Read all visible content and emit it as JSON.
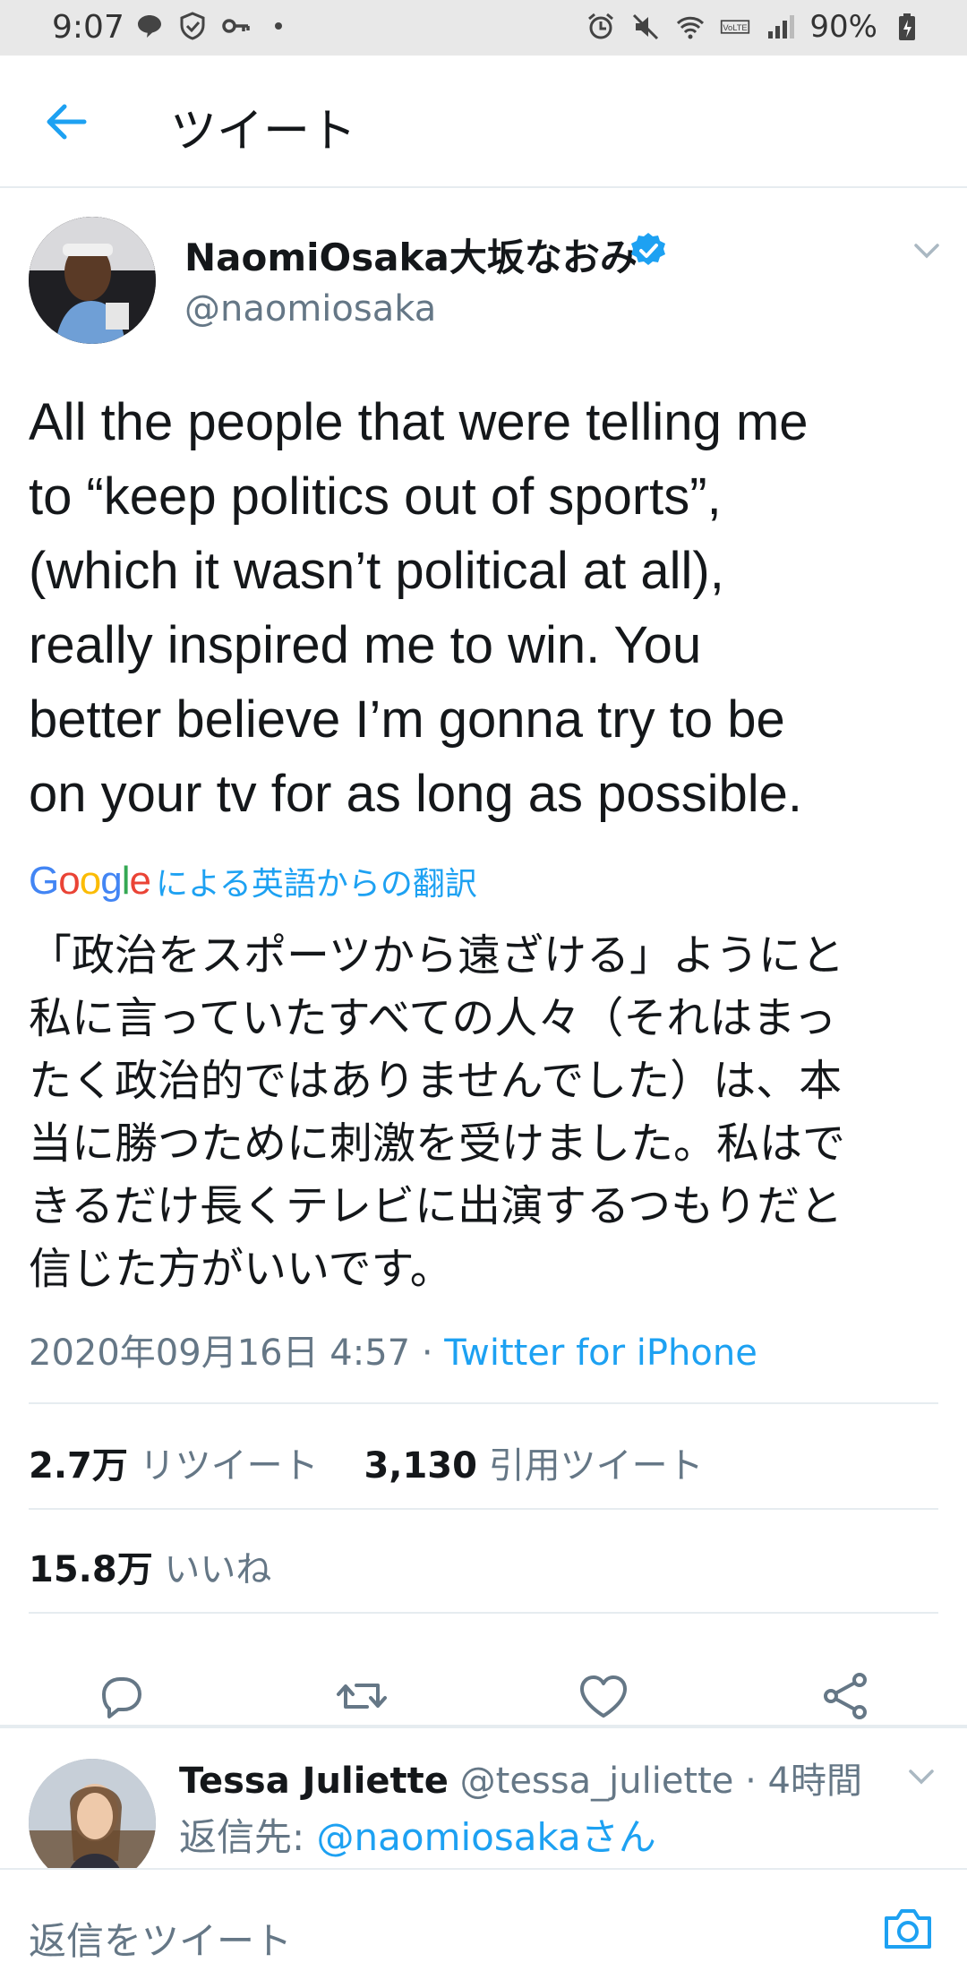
{
  "status_bar": {
    "time": "9:07",
    "battery": "90%",
    "left_icons": [
      "line-icon",
      "shield-check-icon",
      "key-icon",
      "dot-icon"
    ],
    "right_icons": [
      "alarm-icon",
      "mute-icon",
      "wifi-icon",
      "volte-icon",
      "signal-icon",
      "battery-charging-icon"
    ]
  },
  "header": {
    "title": "ツイート"
  },
  "tweet": {
    "author_name": "NaomiOsaka大坂なおみ",
    "author_handle": "@naomiosaka",
    "text_lines": [
      "All the people that were telling me",
      "to “keep politics out of sports”,",
      "(which it wasn’t political at all),",
      "really inspired me to win. You",
      "better believe I’m gonna try to be",
      "on your tv for as long as possible."
    ],
    "translate_label": "による英語からの翻訳",
    "google_logo": "Google",
    "translated_lines": [
      "「政治をスポーツから遠ざける」ようにと",
      "私に言っていたすべての人々（それはまっ",
      "たく政治的ではありませんでした）は、本",
      "当に勝つために刺激を受けました。私はで",
      "きるだけ長くテレビに出演するつもりだと",
      "信じた方がいいです。"
    ],
    "timestamp": "2020年09月16日 4:57",
    "separator": " · ",
    "source": "Twitter for iPhone",
    "retweets_count": "2.7万",
    "retweets_label": "リツイート",
    "quotes_count": "3,130",
    "quotes_label": "引用ツイート",
    "likes_count": "15.8万",
    "likes_label": "いいね"
  },
  "reply": {
    "name": "Tessa Juliette",
    "handle": " @tessa_juliette · 4時間",
    "reply_to_label": "返信先: ",
    "reply_to_mention": "@naomiosakaさん"
  },
  "compose": {
    "placeholder": "返信をツイート"
  },
  "colors": {
    "accent": "#1da1f2",
    "secondary_text": "#657786",
    "divider": "#e6ecf0"
  }
}
